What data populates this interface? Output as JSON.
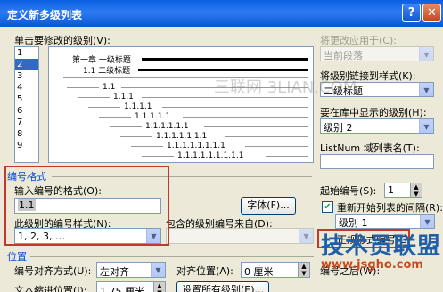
{
  "window": {
    "title": "定义新多级列表",
    "help_label": "?",
    "close_label": "✕"
  },
  "level": {
    "label": "单击要修改的级别(V):",
    "items": [
      "1",
      "2",
      "3",
      "4",
      "5",
      "6",
      "7",
      "8",
      "9"
    ],
    "selected": "2"
  },
  "preview": {
    "line1": "第一章 一级标题",
    "line2": "1.1 二级标题",
    "rows": [
      "1.1",
      "1.1.1",
      "1.1.1.1",
      "1.1.1.1.1",
      "1.1.1.1.1.1",
      "1.1.1.1.1.1.1",
      "1.1.1.1.1.1.1.1",
      "1.1.1.1.1.1.1.1.1"
    ]
  },
  "right_panel": {
    "apply_label": "将更改应用于(C):",
    "apply_value": "当前段落",
    "link_label": "将级别链接到样式(K):",
    "link_value": "二级标题",
    "gallery_label": "要在库中显示的级别(H):",
    "gallery_value": "级别 2",
    "listnum_label": "ListNum 域列表名(T):",
    "listnum_value": "",
    "start_label": "起始编号(S):",
    "start_value": "1",
    "restart_label": "重新开始列表的间隔(R):",
    "restart_checked": true,
    "restart_value": "级别 1",
    "legal_label": "正规形式编号(G)",
    "follow_label": "编号之后(W):"
  },
  "numbering": {
    "section_title": "编号格式",
    "format_label": "输入编号的格式(O):",
    "format_value": "1.1",
    "font_button": "字体(F)...",
    "style_label": "此级别的编号样式(N):",
    "style_value": "1, 2, 3, …",
    "include_label": "包含的级别编号来自(D):"
  },
  "position": {
    "section_title": "位置",
    "align_label": "编号对齐方式(U):",
    "align_value": "左对齐",
    "aligned_at_label": "对齐位置(A):",
    "aligned_at_value": "0 厘米",
    "indent_label": "文本缩进位置(I):",
    "indent_value": "1.75 厘米",
    "set_all_button": "设置所有级别(E)..."
  },
  "watermark": {
    "text": "三联网 3LIAN.COM",
    "brand": "技术员联盟",
    "url": "www.jsgho.com"
  },
  "colors": {
    "highlight": "#c0392b",
    "selection": "#316AC5"
  }
}
